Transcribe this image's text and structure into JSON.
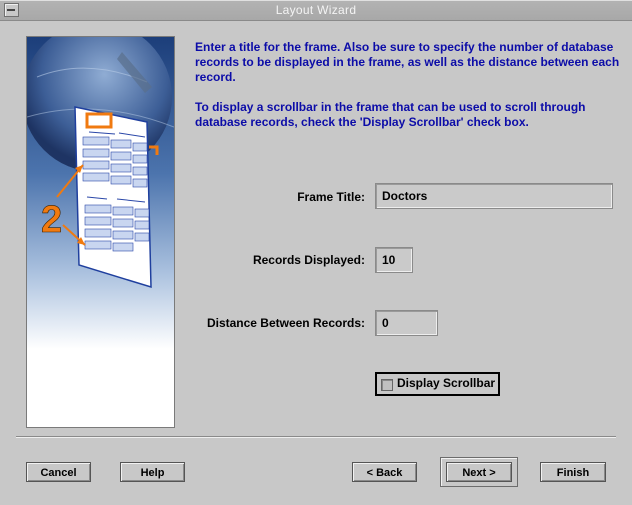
{
  "window": {
    "title": "Layout Wizard"
  },
  "instructions": {
    "paragraph1": "Enter a title for the frame. Also be sure to specify the number of database records to be displayed in the frame, as well as the distance between each record.",
    "paragraph2": "To display a scrollbar in the frame that can be used to scroll through database records, check the 'Display Scrollbar' check box."
  },
  "form": {
    "frame_title": {
      "label": "Frame Title:",
      "value": "Doctors"
    },
    "records_displayed": {
      "label": "Records Displayed:",
      "value": "10"
    },
    "distance_between_records": {
      "label": "Distance Between Records:",
      "value": "0"
    },
    "display_scrollbar": {
      "label": "Display Scrollbar",
      "checked": false
    }
  },
  "illustration": {
    "step_number": "2"
  },
  "buttons": {
    "cancel": "Cancel",
    "help": "Help",
    "back": "< Back",
    "next": "Next >",
    "finish": "Finish"
  },
  "colors": {
    "instruction_text": "#0c0ca8",
    "window_bg": "#c8c8c8",
    "accent_orange": "#f07a10"
  }
}
